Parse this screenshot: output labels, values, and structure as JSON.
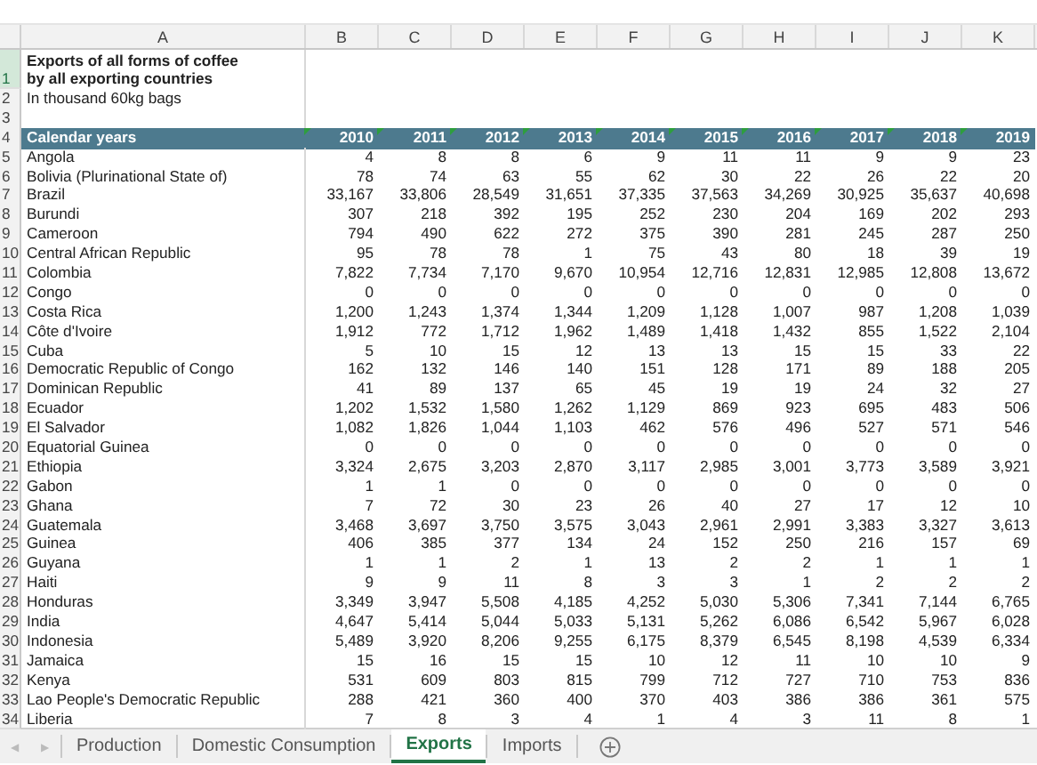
{
  "columns": [
    "A",
    "B",
    "C",
    "D",
    "E",
    "F",
    "G",
    "H",
    "I",
    "J",
    "K"
  ],
  "title_row": {
    "number": "1",
    "lines": [
      "Exports of all forms of coffee",
      "by all exporting countries"
    ],
    "selected": true
  },
  "subtitle_row": {
    "number": "2",
    "text": "In thousand 60kg bags"
  },
  "blank_row": {
    "number": "3"
  },
  "header_row": {
    "number": "4",
    "label": "Calendar years",
    "years": [
      "2010",
      "2011",
      "2012",
      "2013",
      "2014",
      "2015",
      "2016",
      "2017",
      "2018",
      "2019"
    ]
  },
  "rows": [
    {
      "number": "5",
      "country": "Angola",
      "values": [
        "4",
        "8",
        "8",
        "6",
        "9",
        "11",
        "11",
        "9",
        "9",
        "23"
      ]
    },
    {
      "number": "6",
      "country": "Bolivia (Plurinational State of)",
      "values": [
        "78",
        "74",
        "63",
        "55",
        "62",
        "30",
        "22",
        "26",
        "22",
        "20"
      ]
    },
    {
      "number": "7",
      "country": "Brazil",
      "values": [
        "33,167",
        "33,806",
        "28,549",
        "31,651",
        "37,335",
        "37,563",
        "34,269",
        "30,925",
        "35,637",
        "40,698"
      ]
    },
    {
      "number": "8",
      "country": "Burundi",
      "values": [
        "307",
        "218",
        "392",
        "195",
        "252",
        "230",
        "204",
        "169",
        "202",
        "293"
      ]
    },
    {
      "number": "9",
      "country": "Cameroon",
      "values": [
        "794",
        "490",
        "622",
        "272",
        "375",
        "390",
        "281",
        "245",
        "287",
        "250"
      ]
    },
    {
      "number": "10",
      "country": "Central African Republic",
      "values": [
        "95",
        "78",
        "78",
        "1",
        "75",
        "43",
        "80",
        "18",
        "39",
        "19"
      ]
    },
    {
      "number": "11",
      "country": "Colombia",
      "values": [
        "7,822",
        "7,734",
        "7,170",
        "9,670",
        "10,954",
        "12,716",
        "12,831",
        "12,985",
        "12,808",
        "13,672"
      ]
    },
    {
      "number": "12",
      "country": "Congo",
      "values": [
        "0",
        "0",
        "0",
        "0",
        "0",
        "0",
        "0",
        "0",
        "0",
        "0"
      ]
    },
    {
      "number": "13",
      "country": "Costa Rica",
      "values": [
        "1,200",
        "1,243",
        "1,374",
        "1,344",
        "1,209",
        "1,128",
        "1,007",
        "987",
        "1,208",
        "1,039"
      ]
    },
    {
      "number": "14",
      "country": "Côte d'Ivoire",
      "values": [
        "1,912",
        "772",
        "1,712",
        "1,962",
        "1,489",
        "1,418",
        "1,432",
        "855",
        "1,522",
        "2,104"
      ]
    },
    {
      "number": "15",
      "country": "Cuba",
      "values": [
        "5",
        "10",
        "15",
        "12",
        "13",
        "13",
        "15",
        "15",
        "33",
        "22"
      ]
    },
    {
      "number": "16",
      "country": "Democratic Republic of Congo",
      "values": [
        "162",
        "132",
        "146",
        "140",
        "151",
        "128",
        "171",
        "89",
        "188",
        "205"
      ]
    },
    {
      "number": "17",
      "country": "Dominican Republic",
      "values": [
        "41",
        "89",
        "137",
        "65",
        "45",
        "19",
        "19",
        "24",
        "32",
        "27"
      ]
    },
    {
      "number": "18",
      "country": "Ecuador",
      "values": [
        "1,202",
        "1,532",
        "1,580",
        "1,262",
        "1,129",
        "869",
        "923",
        "695",
        "483",
        "506"
      ]
    },
    {
      "number": "19",
      "country": "El Salvador",
      "values": [
        "1,082",
        "1,826",
        "1,044",
        "1,103",
        "462",
        "576",
        "496",
        "527",
        "571",
        "546"
      ]
    },
    {
      "number": "20",
      "country": "Equatorial Guinea",
      "values": [
        "0",
        "0",
        "0",
        "0",
        "0",
        "0",
        "0",
        "0",
        "0",
        "0"
      ]
    },
    {
      "number": "21",
      "country": "Ethiopia",
      "values": [
        "3,324",
        "2,675",
        "3,203",
        "2,870",
        "3,117",
        "2,985",
        "3,001",
        "3,773",
        "3,589",
        "3,921"
      ]
    },
    {
      "number": "22",
      "country": "Gabon",
      "values": [
        "1",
        "1",
        "0",
        "0",
        "0",
        "0",
        "0",
        "0",
        "0",
        "0"
      ]
    },
    {
      "number": "23",
      "country": "Ghana",
      "values": [
        "7",
        "72",
        "30",
        "23",
        "26",
        "40",
        "27",
        "17",
        "12",
        "10"
      ]
    },
    {
      "number": "24",
      "country": "Guatemala",
      "values": [
        "3,468",
        "3,697",
        "3,750",
        "3,575",
        "3,043",
        "2,961",
        "2,991",
        "3,383",
        "3,327",
        "3,613"
      ]
    },
    {
      "number": "25",
      "country": "Guinea",
      "values": [
        "406",
        "385",
        "377",
        "134",
        "24",
        "152",
        "250",
        "216",
        "157",
        "69"
      ]
    },
    {
      "number": "26",
      "country": "Guyana",
      "values": [
        "1",
        "1",
        "2",
        "1",
        "13",
        "2",
        "2",
        "1",
        "1",
        "1"
      ]
    },
    {
      "number": "27",
      "country": "Haiti",
      "values": [
        "9",
        "9",
        "11",
        "8",
        "3",
        "3",
        "1",
        "2",
        "2",
        "2"
      ]
    },
    {
      "number": "28",
      "country": "Honduras",
      "values": [
        "3,349",
        "3,947",
        "5,508",
        "4,185",
        "4,252",
        "5,030",
        "5,306",
        "7,341",
        "7,144",
        "6,765"
      ]
    },
    {
      "number": "29",
      "country": "India",
      "values": [
        "4,647",
        "5,414",
        "5,044",
        "5,033",
        "5,131",
        "5,262",
        "6,086",
        "6,542",
        "5,967",
        "6,028"
      ]
    },
    {
      "number": "30",
      "country": "Indonesia",
      "values": [
        "5,489",
        "3,920",
        "8,206",
        "9,255",
        "6,175",
        "8,379",
        "6,545",
        "8,198",
        "4,539",
        "6,334"
      ]
    },
    {
      "number": "31",
      "country": "Jamaica",
      "values": [
        "15",
        "16",
        "15",
        "15",
        "10",
        "12",
        "11",
        "10",
        "10",
        "9"
      ]
    },
    {
      "number": "32",
      "country": "Kenya",
      "values": [
        "531",
        "609",
        "803",
        "815",
        "799",
        "712",
        "727",
        "710",
        "753",
        "836"
      ]
    },
    {
      "number": "33",
      "country": "Lao People's Democratic Republic",
      "values": [
        "288",
        "421",
        "360",
        "400",
        "370",
        "403",
        "386",
        "386",
        "361",
        "575"
      ]
    },
    {
      "number": "34",
      "country": "Liberia",
      "values": [
        "7",
        "8",
        "3",
        "4",
        "1",
        "4",
        "3",
        "11",
        "8",
        "1"
      ]
    }
  ],
  "scroll_arrows": [
    "◀",
    "▶"
  ],
  "tabs": [
    {
      "label": "Production",
      "selected": false
    },
    {
      "label": "Domestic Consumption",
      "selected": false
    },
    {
      "label": "Exports",
      "selected": true
    },
    {
      "label": "Imports",
      "selected": false
    }
  ]
}
